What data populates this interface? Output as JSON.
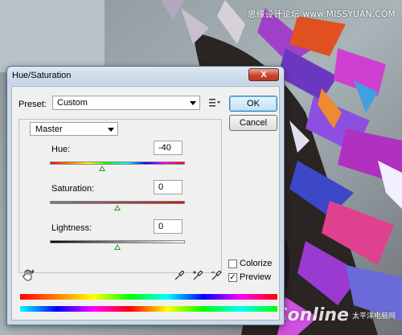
{
  "watermark": {
    "top_text": "思缘设计论坛 www.MISSYUAN.COM",
    "brand_logo": "PConline",
    "brand_cn_line1": "太平洋电脑网"
  },
  "dialog": {
    "title": "Hue/Saturation",
    "close_glyph": "X",
    "preset_label": "Preset:",
    "preset_value": "Custom",
    "ok_label": "OK",
    "cancel_label": "Cancel",
    "channel_value": "Master",
    "hue": {
      "label": "Hue:",
      "value": "-40",
      "level": -40,
      "min": -180,
      "max": 180
    },
    "saturation": {
      "label": "Saturation:",
      "value": "0",
      "level": 0,
      "min": -100,
      "max": 100
    },
    "lightness": {
      "label": "Lightness:",
      "value": "0",
      "level": 0,
      "min": -100,
      "max": 100
    },
    "colorize": {
      "label": "Colorize",
      "checked": false
    },
    "preview": {
      "label": "Preview",
      "checked": true,
      "mark": "✓"
    },
    "icons": [
      "hand-tool-icon",
      "eyedropper-icon",
      "eyedropper-plus-icon",
      "eyedropper-minus-icon",
      "preset-options-icon"
    ]
  }
}
